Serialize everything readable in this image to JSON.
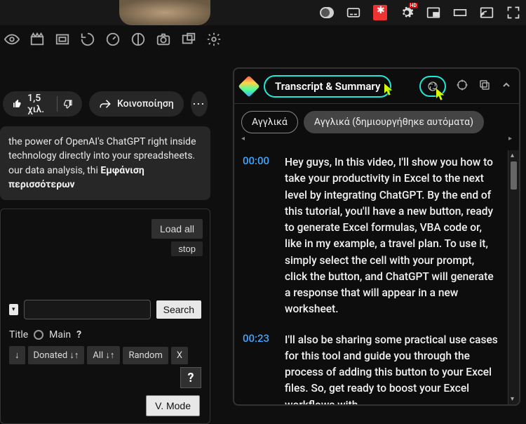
{
  "topbar": {
    "gear_badge": "HD"
  },
  "engagement": {
    "likes": "1,5 χιλ.",
    "share_label": "Κοινοποίηση",
    "more_dots": "⋯"
  },
  "description": {
    "line1": "the power of OpenAI's ChatGPT right inside",
    "line2": "technology directly into your spreadsheets.",
    "line3_prefix": "our data analysis, thi ",
    "show_more": "Εμφάνιση περισσότερων"
  },
  "comments": {
    "load_all": "Load all",
    "stop": "stop",
    "search_btn": "Search",
    "title_label": "Title",
    "main_label": "Main",
    "help_q": "?",
    "help_mark": "?",
    "sort1": "↓",
    "donated": "Donated ↓↑",
    "all": "All ↓↑",
    "random": "Random",
    "x": "X",
    "vmode": "V. Mode"
  },
  "panel": {
    "title": "Transcript & Summary",
    "lang1": "Αγγλικά",
    "lang2": "Αγγλικά (δημιουργήθηκε αυτόματα)"
  },
  "transcript": [
    {
      "time": "00:00",
      "text": "Hey guys, In this video, I'll show you how to take your productivity in Excel to the next level by integrating ChatGPT. By the end of this tutorial, you'll have a new button, ready to generate Excel formulas, VBA code or, like in my example, a travel plan. To use it, simply select the cell with your prompt, click the button, and ChatGPT will generate a response that will appear in a new worksheet."
    },
    {
      "time": "00:23",
      "text": "I'll also be sharing some practical use cases for this tool and guide you through the process of adding this button to your Excel files. So, get ready to boost your Excel workflows with"
    }
  ]
}
